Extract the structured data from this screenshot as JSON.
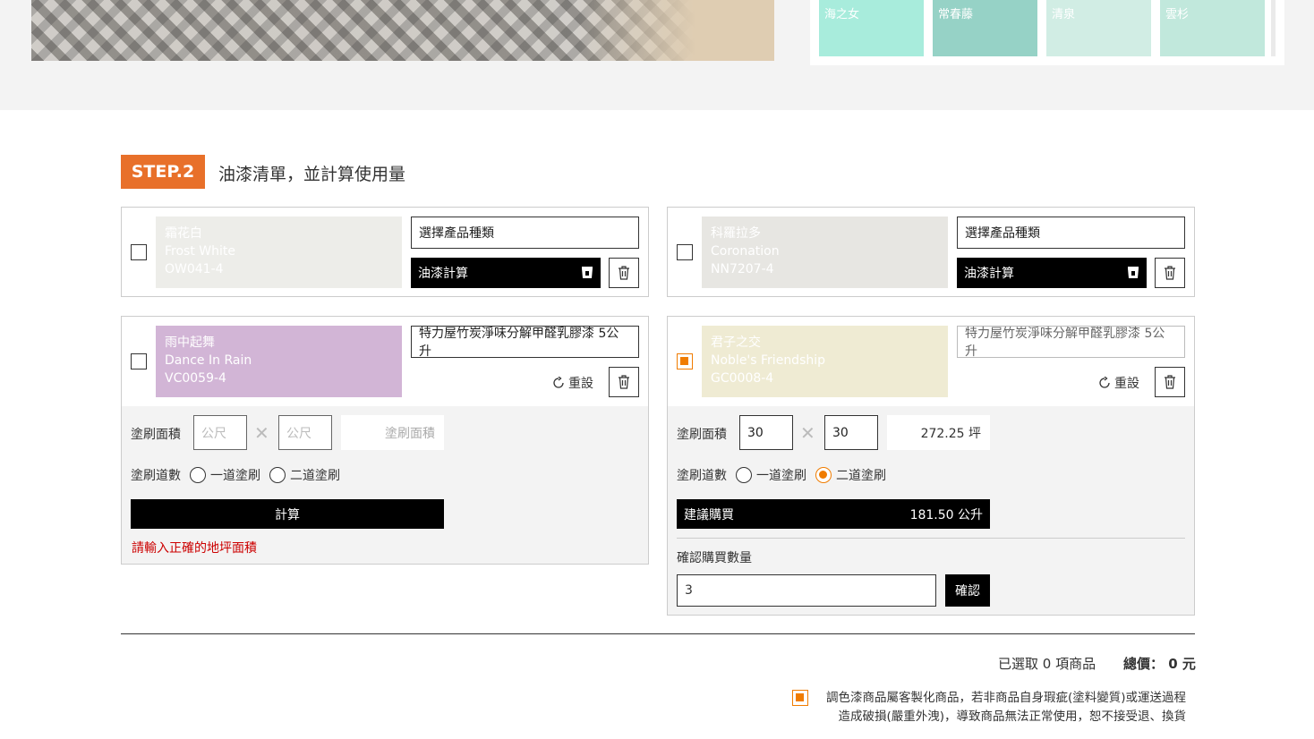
{
  "colors": {
    "accent": "#e8702a",
    "checkbox_orange": "#f07c00",
    "error": "#cc0000"
  },
  "top_swatches": [
    {
      "name": "海之女",
      "color": "#a8ecdc"
    },
    {
      "name": "常春藤",
      "color": "#96d2c6"
    },
    {
      "name": "清泉",
      "color": "#d1ede4"
    },
    {
      "name": "雲杉",
      "color": "#c1e8dc"
    }
  ],
  "step": {
    "badge": "STEP.2",
    "title": "油漆清單，並計算使用量"
  },
  "cards": [
    {
      "checked": false,
      "color_zh": "霜花白",
      "color_en": "Frost White",
      "code": "OW041-4",
      "swatch": "#edede9",
      "product_select": "選擇產品種類",
      "calc_label": "油漆計算"
    },
    {
      "checked": false,
      "color_zh": "科羅拉多",
      "color_en": "Coronation",
      "code": "NN7207-4",
      "swatch": "#e7e6e2",
      "product_select": "選擇產品種類",
      "calc_label": "油漆計算"
    },
    {
      "checked": false,
      "color_zh": "雨中起舞",
      "color_en": "Dance In Rain",
      "code": "VC0059-4",
      "swatch": "#d2b5d6",
      "product_select": "特力屋竹炭淨味分解甲醛乳膠漆 5公升",
      "reset_label": "重設",
      "area_label": "塗刷面積",
      "width_placeholder": "公尺",
      "height_placeholder": "公尺",
      "area_result_placeholder": "塗刷面積",
      "coats_label": "塗刷道數",
      "coat_one": "一道塗刷",
      "coat_two": "二道塗刷",
      "calc_button": "計算",
      "error": "請輸入正確的地坪面積"
    },
    {
      "checked": true,
      "color_zh": "君子之交",
      "color_en": "Noble's Friendship",
      "code": "GC0008-4",
      "swatch": "#efebd3",
      "product_select": "特力屋竹炭淨味分解甲醛乳膠漆 5公升",
      "reset_label": "重設",
      "area_label": "塗刷面積",
      "width_value": "30",
      "height_value": "30",
      "area_result": "272.25 坪",
      "coats_label": "塗刷道數",
      "coat_one": "一道塗刷",
      "coat_two": "二道塗刷",
      "suggest_label": "建議購買",
      "suggest_value": "181.50 公升",
      "confirm_qty_label": "確認購買數量",
      "qty_value": "3",
      "confirm_button": "確認"
    }
  ],
  "summary": {
    "selected": "已選取 0 項商品",
    "total": "總價： 0 元"
  },
  "notice": {
    "line1": "調色漆商品屬客製化商品，若非商品自身瑕疵(塗料變質)或運送過程",
    "line2": "造成破損(嚴重外洩)，導致商品無法正常使用，恕不接受退、換貨"
  }
}
